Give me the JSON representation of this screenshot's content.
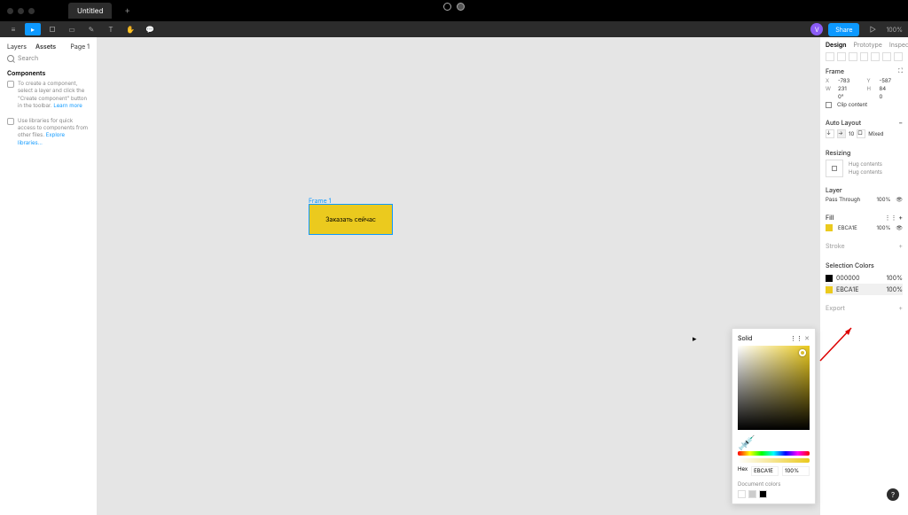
{
  "titlebar": {
    "tab_name": "Untitled"
  },
  "toolbar": {
    "avatar_initial": "V",
    "share_label": "Share",
    "zoom": "100%"
  },
  "left_panel": {
    "tab_layers": "Layers",
    "tab_assets": "Assets",
    "page_label": "Page 1",
    "search_placeholder": "Search",
    "components_title": "Components",
    "help1_text": "To create a component, select a layer and click the \"Create component\" button in the toolbar.",
    "help1_link": "Learn more",
    "help2_text": "Use libraries for quick access to components from other files.",
    "help2_link": "Explore libraries..."
  },
  "canvas": {
    "frame_label": "Frame 1",
    "frame_text": "Заказать сейчас"
  },
  "right_panel": {
    "tab_design": "Design",
    "tab_prototype": "Prototype",
    "tab_inspect": "Inspect",
    "frame_title": "Frame",
    "x_label": "X",
    "x_val": "-783",
    "y_label": "Y",
    "y_val": "-587",
    "w_label": "W",
    "w_val": "231",
    "h_label": "H",
    "h_val": "84",
    "r_label": "",
    "r_val": "0°",
    "c_label": "",
    "c_val": "0",
    "clip_label": "Clip content",
    "autolayout_title": "Auto Layout",
    "al_gap": "10",
    "al_padding": "Mixed",
    "resizing_title": "Resizing",
    "hug_w": "Hug contents",
    "hug_h": "Hug contents",
    "layer_title": "Layer",
    "blend_mode": "Pass Through",
    "layer_opacity": "100%",
    "fill_title": "Fill",
    "fill_hex": "EBCA1E",
    "fill_opacity": "100%",
    "stroke_title": "Stroke",
    "selcolors_title": "Selection Colors",
    "sel1_hex": "000000",
    "sel1_opacity": "100%",
    "sel2_hex": "EBCA1E",
    "sel2_opacity": "100%",
    "export_title": "Export"
  },
  "color_picker": {
    "mode": "Solid",
    "hex_label": "Hex",
    "hex_val": "EBCA1E",
    "opacity": "100%",
    "doc_colors_label": "Document colors"
  },
  "help_fab": "?"
}
